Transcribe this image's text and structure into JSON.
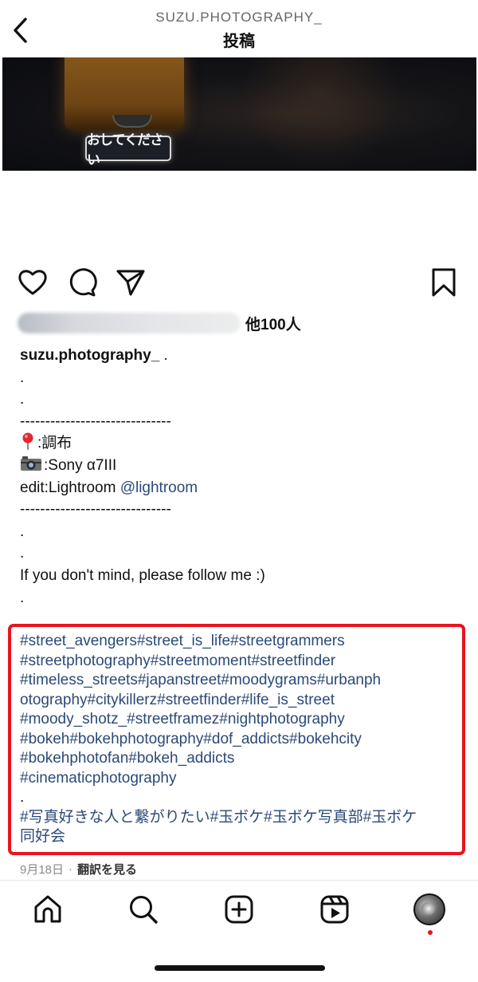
{
  "header": {
    "account": "SUZU.PHOTOGRAPHY_",
    "title": "投稿"
  },
  "image": {
    "sign_text": "おしてください"
  },
  "likes": {
    "count_text": "他100人"
  },
  "caption": {
    "username": "suzu.photography_",
    "first_line_suffix": " .",
    "dot": ".",
    "divider": "------------------------------",
    "location_text": ":調布",
    "camera_text": ":Sony α7III",
    "edit_prefix": "edit:Lightroom ",
    "edit_mention": "@lightroom",
    "follow_text": "If you don't mind, please follow me :)"
  },
  "hashtags": {
    "lines": [
      "#street_avengers#street_is_life#streetgrammers",
      "#streetphotography#streetmoment#streetfinder",
      "#timeless_streets#japanstreet#moodygrams#urbanph",
      "otography#citykillerz#streetfinder#life_is_street",
      "#moody_shotz_#streetframez#nightphotography",
      "#bokeh#bokehphotography#dof_addicts#bokehcity",
      "#bokehphotofan#bokeh_addicts",
      "#cinematicphotography"
    ],
    "dot": ".",
    "jp_lines": [
      "#写真好きな人と繋がりたい#玉ボケ#玉ボケ写真部#玉ボケ",
      "同好会"
    ]
  },
  "meta": {
    "date": "9月18日",
    "separator": "·",
    "translate": "翻訳を見る"
  },
  "tabs": [
    {
      "icon": "home-icon"
    },
    {
      "icon": "search-icon"
    },
    {
      "icon": "create-post-icon"
    },
    {
      "icon": "reels-icon"
    },
    {
      "icon": "profile-avatar"
    }
  ],
  "colors": {
    "link": "#2b4a78",
    "highlight_border": "#e8141e",
    "notification_dot": "#e8141e"
  }
}
